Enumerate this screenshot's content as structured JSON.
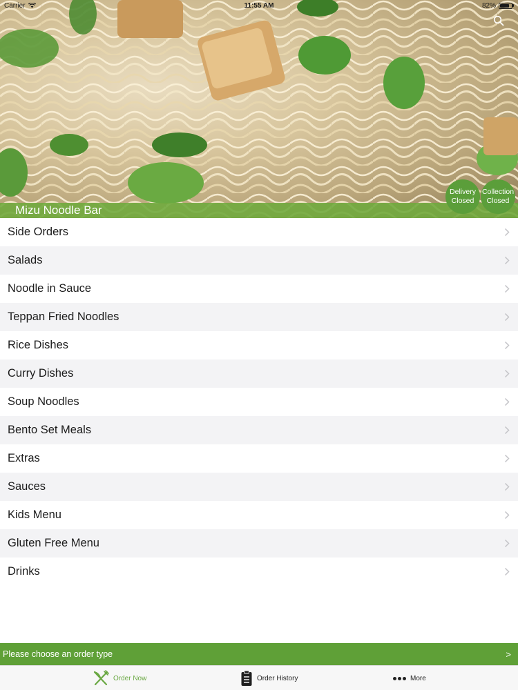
{
  "status_bar": {
    "carrier": "Carrier",
    "time": "11:55 AM",
    "battery": "82%",
    "battery_level": 0.82
  },
  "header": {
    "title": "Mizu Noodle Bar",
    "search_icon": "search-icon",
    "badges": {
      "delivery": {
        "line1": "Delivery",
        "line2": "Closed"
      },
      "collection": {
        "line1": "Collection",
        "line2": "Closed"
      }
    }
  },
  "menu": {
    "items": [
      {
        "label": "Side Orders"
      },
      {
        "label": "Salads"
      },
      {
        "label": "Noodle in Sauce"
      },
      {
        "label": "Teppan Fried Noodles"
      },
      {
        "label": "Rice Dishes"
      },
      {
        "label": "Curry Dishes"
      },
      {
        "label": "Soup Noodles"
      },
      {
        "label": "Bento Set Meals"
      },
      {
        "label": "Extras"
      },
      {
        "label": "Sauces"
      },
      {
        "label": "Kids Menu"
      },
      {
        "label": "Gluten Free Menu"
      },
      {
        "label": "Drinks"
      }
    ]
  },
  "order_bar": {
    "text": "Please choose an order type",
    "arrow": ">"
  },
  "tabbar": {
    "tabs": [
      {
        "label": "Order Now",
        "icon": "fork-knife-icon",
        "active": true
      },
      {
        "label": "Order History",
        "icon": "clipboard-icon",
        "active": false
      },
      {
        "label": "More",
        "icon": "more-dots-icon",
        "active": false
      }
    ]
  },
  "colors": {
    "accent": "#5fa037",
    "badge": "#5b9e3a",
    "active_tab": "#6aa843"
  }
}
